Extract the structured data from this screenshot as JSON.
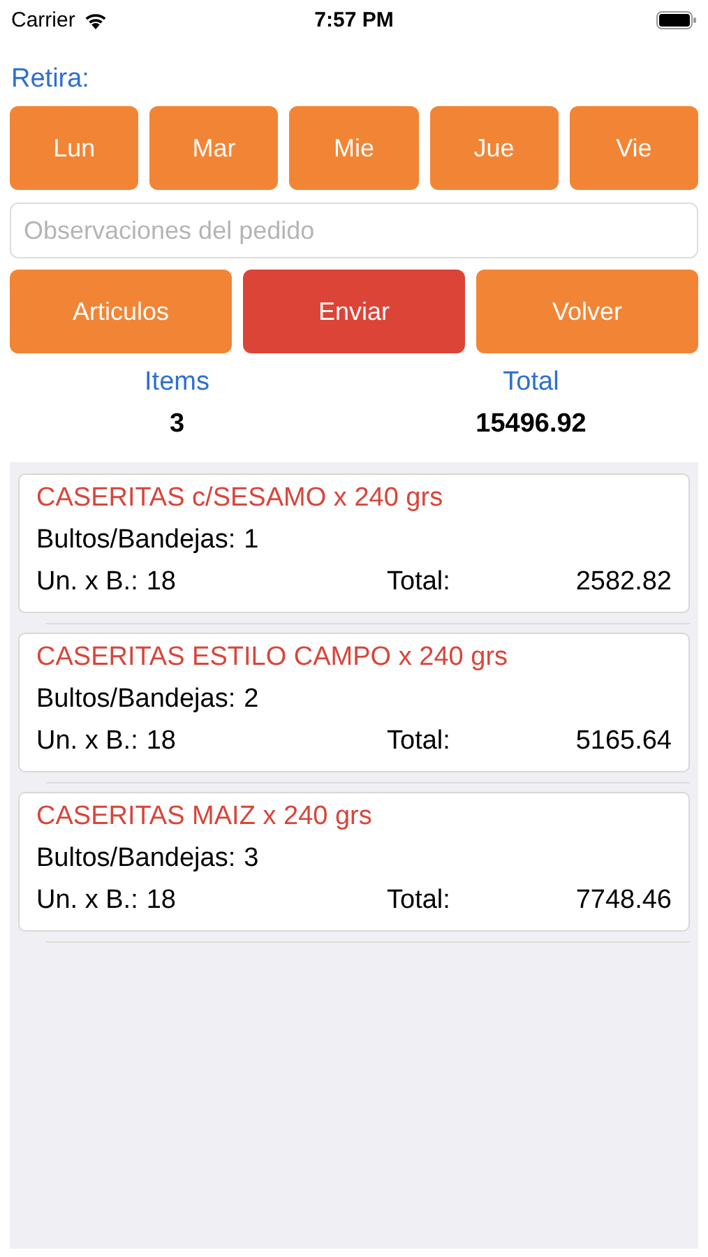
{
  "status_bar": {
    "carrier": "Carrier",
    "time": "7:57 PM"
  },
  "pickup_label": "Retira:",
  "days": [
    {
      "label": "Lun"
    },
    {
      "label": "Mar"
    },
    {
      "label": "Mie"
    },
    {
      "label": "Jue"
    },
    {
      "label": "Vie"
    }
  ],
  "notes_field": {
    "placeholder": "Observaciones del pedido"
  },
  "actions": [
    {
      "label": "Articulos",
      "kind": "normal"
    },
    {
      "label": "Enviar",
      "kind": "primary"
    },
    {
      "label": "Volver",
      "kind": "normal"
    }
  ],
  "summary": [
    {
      "label": "Items",
      "value": "3"
    },
    {
      "label": "Total",
      "value": "15496.92"
    }
  ],
  "items": [
    {
      "name": "CASERITAS c/SESAMO x 240 grs",
      "packs_label": "Bultos/Bandejas:",
      "packs": "1",
      "units_label": "Un. x B.:",
      "units": "18",
      "total_label": "Total:",
      "total": "2582.82"
    },
    {
      "name": "CASERITAS ESTILO CAMPO x 240 grs",
      "packs_label": "Bultos/Bandejas:",
      "packs": "2",
      "units_label": "Un. x B.:",
      "units": "18",
      "total_label": "Total:",
      "total": "5165.64"
    },
    {
      "name": "CASERITAS MAIZ x 240 grs",
      "packs_label": "Bultos/Bandejas:",
      "packs": "3",
      "units_label": "Un. x B.:",
      "units": "18",
      "total_label": "Total:",
      "total": "7748.46"
    }
  ]
}
